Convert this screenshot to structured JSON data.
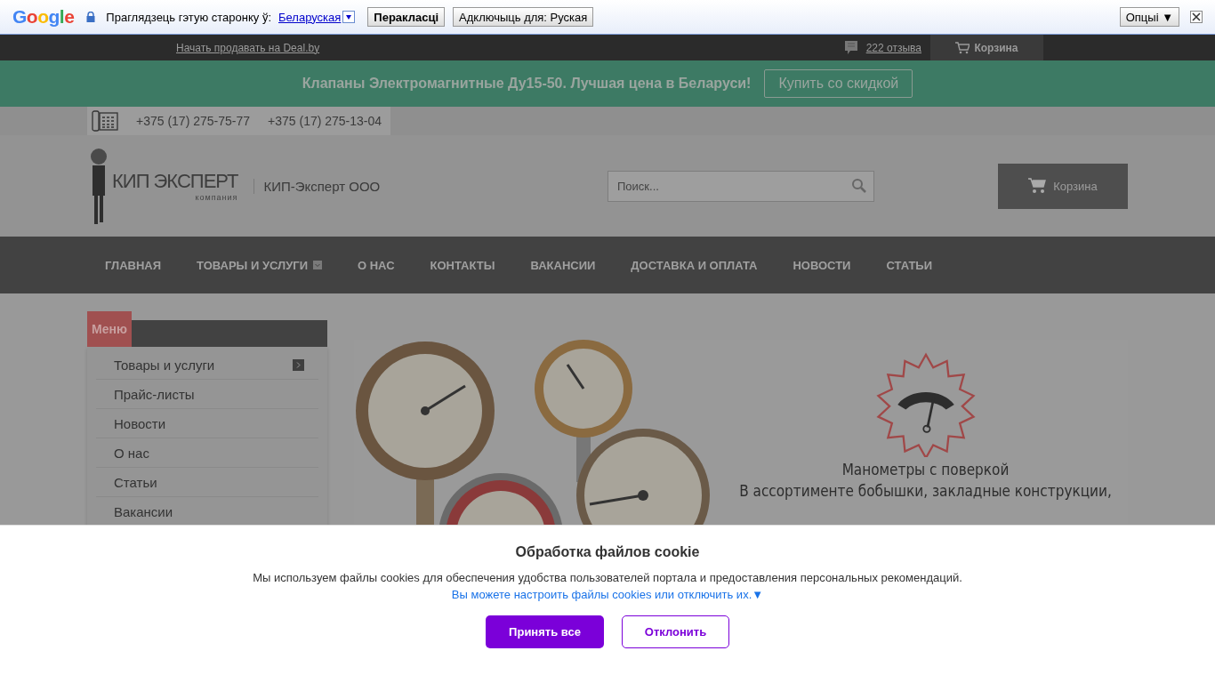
{
  "translate_bar": {
    "logo": "Google",
    "prompt": "Праглядзець гэтую старонку ў:",
    "language": "Беларуская",
    "translate_button": "Перакласці",
    "disable_button": "Адключыць для: Руская",
    "options_button": "Опцыі ▼"
  },
  "top_bar": {
    "sell_link": "Начать продавать на Deal.by",
    "reviews_link": "222 отзыва",
    "cart": "Корзина"
  },
  "promo": {
    "text": "Клапаны Электромагнитные Ду15-50. Лучшая цена в Беларуси!",
    "button": "Купить со скидкой"
  },
  "phones": [
    "+375 (17) 275-75-77",
    "+375 (17) 275-13-04"
  ],
  "header": {
    "logo_text": "КИП ЭКСПЕРТ",
    "logo_tagline": "компания",
    "company": "КИП-Эксперт ООО",
    "search": {
      "placeholder": "Поиск..."
    },
    "cart_button": "Корзина"
  },
  "nav": [
    {
      "label": "ГЛАВНАЯ",
      "dropdown": false
    },
    {
      "label": "ТОВАРЫ И УСЛУГИ",
      "dropdown": true
    },
    {
      "label": "О НАС",
      "dropdown": false
    },
    {
      "label": "КОНТАКТЫ",
      "dropdown": false
    },
    {
      "label": "ВАКАНСИИ",
      "dropdown": false
    },
    {
      "label": "ДОСТАВКА И ОПЛАТА",
      "dropdown": false
    },
    {
      "label": "НОВОСТИ",
      "dropdown": false
    },
    {
      "label": "СТАТЬИ",
      "dropdown": false
    }
  ],
  "side_menu": {
    "title": "Меню",
    "items": [
      {
        "label": "Товары и услуги",
        "submenu": true
      },
      {
        "label": "Прайс-листы",
        "submenu": false
      },
      {
        "label": "Новости",
        "submenu": false
      },
      {
        "label": "О нас",
        "submenu": false
      },
      {
        "label": "Статьи",
        "submenu": false
      },
      {
        "label": "Вакансии",
        "submenu": false
      }
    ]
  },
  "hero": {
    "title": "Манометры с поверкой",
    "subtitle": "В ассортименте бобышки, закладные конструкции,"
  },
  "cookie": {
    "title": "Обработка файлов cookie",
    "text": "Мы используем файлы cookies для обеспечения удобства пользователей портала и предоставления персональных рекомендаций.",
    "settings_link": "Вы можете настроить файлы cookies или отключить их.▼",
    "accept_button": "Принять все",
    "decline_button": "Отклонить"
  }
}
